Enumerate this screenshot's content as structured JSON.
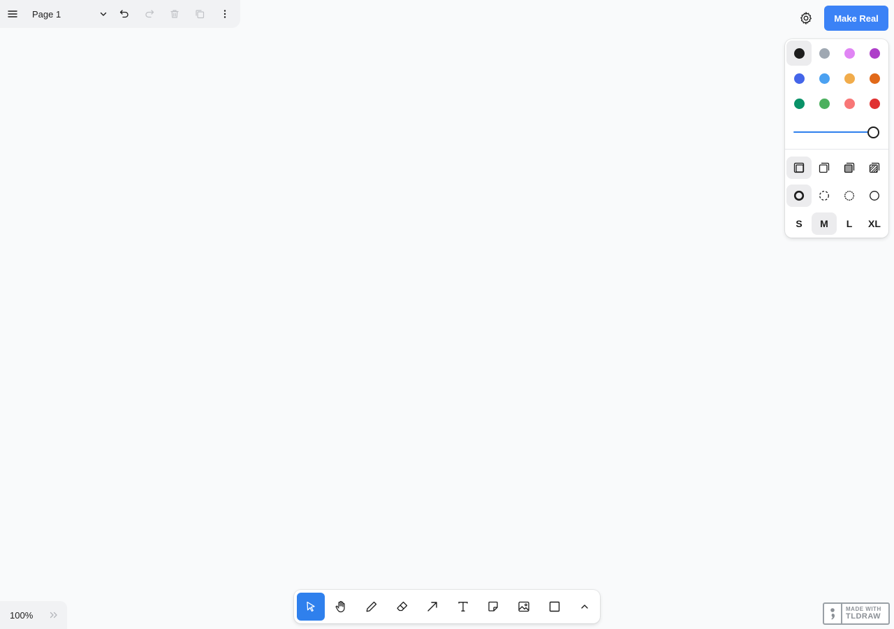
{
  "menu": {
    "page_name": "Page 1",
    "icons": [
      "hamburger-icon",
      "chevron-down-icon",
      "undo-icon",
      "redo-icon",
      "trash-icon",
      "duplicate-icon",
      "more-vertical-icon"
    ]
  },
  "header": {
    "settings_icon": "gear-icon",
    "make_real_label": "Make Real",
    "make_real_color": "#3b82f6"
  },
  "style_panel": {
    "colors": [
      {
        "name": "black",
        "hex": "#1d1d1d",
        "selected": true
      },
      {
        "name": "grey",
        "hex": "#9fa8b2"
      },
      {
        "name": "light-violet",
        "hex": "#e085f4"
      },
      {
        "name": "violet",
        "hex": "#ae3ec9"
      },
      {
        "name": "blue",
        "hex": "#4465e9"
      },
      {
        "name": "light-blue",
        "hex": "#4ba1f1"
      },
      {
        "name": "yellow",
        "hex": "#f1ac4b"
      },
      {
        "name": "orange",
        "hex": "#e16919"
      },
      {
        "name": "green",
        "hex": "#099268"
      },
      {
        "name": "light-green",
        "hex": "#4cb05e"
      },
      {
        "name": "light-red",
        "hex": "#f87777"
      },
      {
        "name": "red",
        "hex": "#e03131"
      }
    ],
    "opacity_value": 1.0,
    "fill_options": [
      "fill-none-icon",
      "fill-semi-icon",
      "fill-solid-icon",
      "fill-pattern-icon"
    ],
    "fill_selected": 0,
    "dash_options": [
      "dash-draw-icon",
      "dash-dashed-icon",
      "dash-dotted-icon",
      "dash-solid-icon"
    ],
    "dash_selected": 0,
    "sizes": [
      "S",
      "M",
      "L",
      "XL"
    ],
    "size_selected": 1
  },
  "toolbar": {
    "tools": [
      "select-icon",
      "hand-icon",
      "draw-icon",
      "eraser-icon",
      "arrow-icon",
      "text-icon",
      "note-icon",
      "image-icon",
      "rectangle-icon"
    ],
    "active_tool": 0,
    "more_icon": "chevron-up-icon"
  },
  "zoom": {
    "value": "100%",
    "minimap_icon": "double-chevron-right-icon"
  },
  "watermark": {
    "line1": "MADE WITH",
    "line2": "TLDRAW"
  }
}
